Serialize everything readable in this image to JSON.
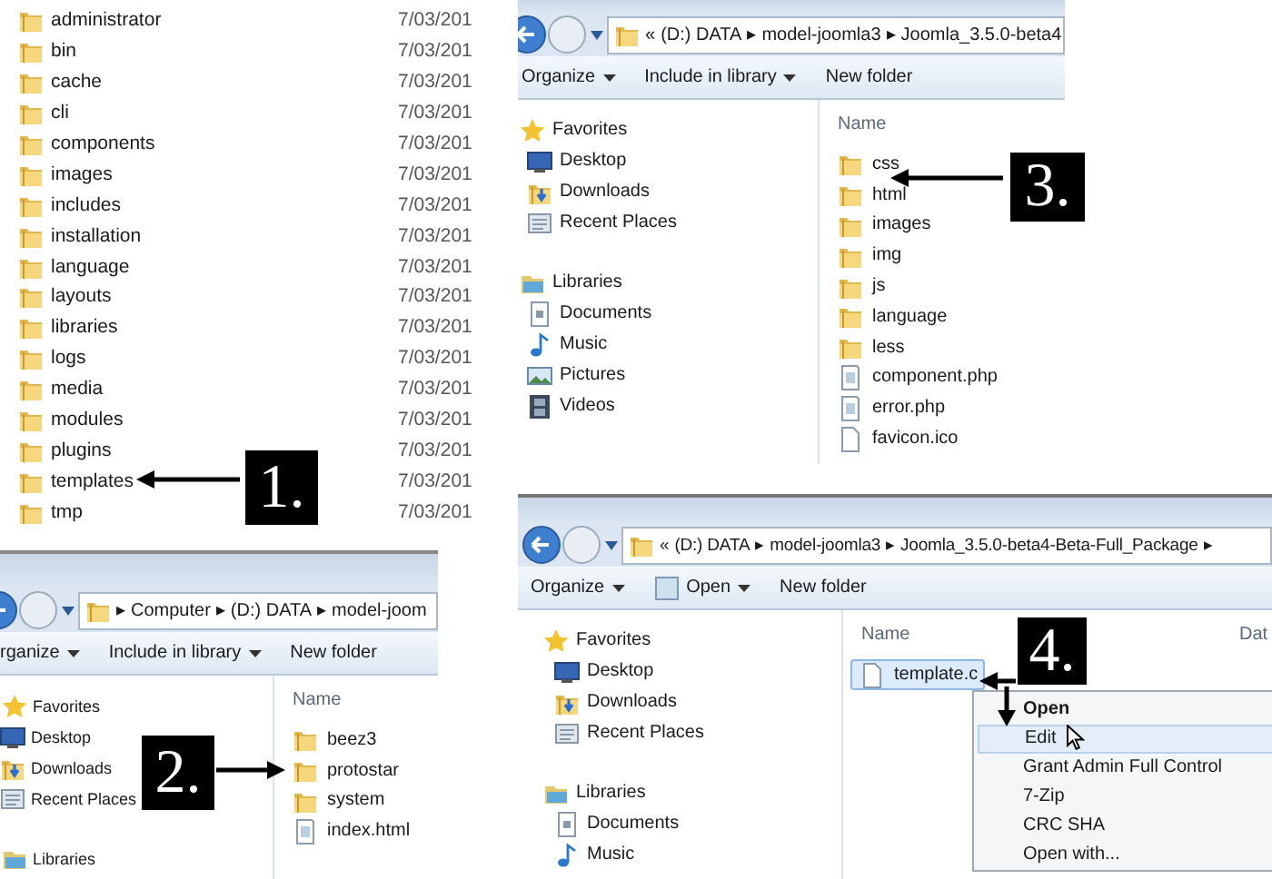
{
  "panels": [
    {
      "kind": "list",
      "rows": [
        {
          "name": "administrator",
          "date": "7/03/201"
        },
        {
          "name": "bin",
          "date": "7/03/201"
        },
        {
          "name": "cache",
          "date": "7/03/201"
        },
        {
          "name": "cli",
          "date": "7/03/201"
        },
        {
          "name": "components",
          "date": "7/03/201"
        },
        {
          "name": "images",
          "date": "7/03/201"
        },
        {
          "name": "includes",
          "date": "7/03/201"
        },
        {
          "name": "installation",
          "date": "7/03/201"
        },
        {
          "name": "language",
          "date": "7/03/201"
        },
        {
          "name": "layouts",
          "date": "7/03/201"
        },
        {
          "name": "libraries",
          "date": "7/03/201"
        },
        {
          "name": "logs",
          "date": "7/03/201"
        },
        {
          "name": "media",
          "date": "7/03/201"
        },
        {
          "name": "modules",
          "date": "7/03/201"
        },
        {
          "name": "plugins",
          "date": "7/03/201"
        },
        {
          "name": "templates",
          "date": "7/03/201"
        },
        {
          "name": "tmp",
          "date": "7/03/201"
        }
      ],
      "callout": {
        "label": "1."
      }
    },
    {
      "kind": "explorer",
      "address": [
        "▸",
        "Computer",
        "▸",
        "(D:) DATA",
        "▸",
        "model-joom"
      ],
      "toolbar": [
        {
          "label": "rganize",
          "dropdown": true,
          "icon": false
        },
        {
          "label": "Include in library",
          "dropdown": true,
          "icon": false
        },
        {
          "label": "New folder",
          "dropdown": false,
          "icon": false
        }
      ],
      "nav": [
        {
          "label": "Favorites",
          "kind": "star",
          "children": [
            {
              "label": "Desktop",
              "kind": "desktop"
            },
            {
              "label": "Downloads",
              "kind": "downloads"
            },
            {
              "label": "Recent Places",
              "kind": "recent"
            }
          ]
        },
        {
          "label": "Libraries",
          "kind": "libraries"
        }
      ],
      "columns": [
        "Name"
      ],
      "files": [
        {
          "name": "beez3",
          "kind": "folder",
          "selected": false
        },
        {
          "name": "protostar",
          "kind": "folder",
          "selected": false
        },
        {
          "name": "system",
          "kind": "folder",
          "selected": false
        },
        {
          "name": "index.html",
          "kind": "page",
          "selected": false
        }
      ],
      "callout": {
        "label": "2."
      }
    },
    {
      "kind": "explorer",
      "address": [
        "«",
        "(D:) DATA",
        "▸",
        "model-joomla3",
        "▸",
        "Joomla_3.5.0-beta4"
      ],
      "toolbar": [
        {
          "label": "Organize",
          "dropdown": true,
          "icon": false
        },
        {
          "label": "Include in library",
          "dropdown": true,
          "icon": false
        },
        {
          "label": "New folder",
          "dropdown": false,
          "icon": false
        }
      ],
      "nav": [
        {
          "label": "Favorites",
          "kind": "star",
          "children": [
            {
              "label": "Desktop",
              "kind": "desktop"
            },
            {
              "label": "Downloads",
              "kind": "downloads"
            },
            {
              "label": "Recent Places",
              "kind": "recent"
            }
          ]
        },
        {
          "label": "Libraries",
          "kind": "libraries",
          "children": [
            {
              "label": "Documents",
              "kind": "documents"
            },
            {
              "label": "Music",
              "kind": "music"
            },
            {
              "label": "Pictures",
              "kind": "pictures"
            },
            {
              "label": "Videos",
              "kind": "videos"
            }
          ]
        }
      ],
      "columns": [
        "Name"
      ],
      "files": [
        {
          "name": "css",
          "kind": "folder",
          "selected": false
        },
        {
          "name": "html",
          "kind": "folder",
          "selected": false
        },
        {
          "name": "images",
          "kind": "folder",
          "selected": false
        },
        {
          "name": "img",
          "kind": "folder",
          "selected": false
        },
        {
          "name": "js",
          "kind": "folder",
          "selected": false
        },
        {
          "name": "language",
          "kind": "folder",
          "selected": false
        },
        {
          "name": "less",
          "kind": "folder",
          "selected": false
        },
        {
          "name": "component.php",
          "kind": "page",
          "selected": false
        },
        {
          "name": "error.php",
          "kind": "page",
          "selected": false
        },
        {
          "name": "favicon.ico",
          "kind": "blank",
          "selected": false
        }
      ],
      "callout": {
        "label": "3."
      }
    },
    {
      "kind": "explorer",
      "address": [
        "«",
        "(D:) DATA",
        "▸",
        "model-joomla3",
        "▸",
        "Joomla_3.5.0-beta4-Beta-Full_Package",
        "▸"
      ],
      "toolbar": [
        {
          "label": "Organize",
          "dropdown": true,
          "icon": false
        },
        {
          "label": "Open",
          "dropdown": true,
          "icon": true
        },
        {
          "label": "New folder",
          "dropdown": false,
          "icon": false
        }
      ],
      "nav": [
        {
          "label": "Favorites",
          "kind": "star",
          "children": [
            {
              "label": "Desktop",
              "kind": "desktop"
            },
            {
              "label": "Downloads",
              "kind": "downloads"
            },
            {
              "label": "Recent Places",
              "kind": "recent"
            }
          ]
        },
        {
          "label": "Libraries",
          "kind": "libraries",
          "children": [
            {
              "label": "Documents",
              "kind": "documents"
            },
            {
              "label": "Music",
              "kind": "music"
            }
          ]
        }
      ],
      "columns": [
        "Name",
        "Dat"
      ],
      "files": [
        {
          "name": "template.c",
          "kind": "blank",
          "selected": true
        }
      ],
      "menu": [
        {
          "label": "Open",
          "default": true,
          "selected": false
        },
        {
          "label": "Edit",
          "default": false,
          "selected": true
        },
        {
          "label": "Grant Admin Full Control",
          "default": false,
          "selected": false
        },
        {
          "label": "7-Zip",
          "default": false,
          "selected": false
        },
        {
          "label": "CRC SHA",
          "default": false,
          "selected": false
        },
        {
          "label": "Open with...",
          "default": false,
          "selected": false
        }
      ],
      "cursor": true,
      "callout": {
        "label": "4."
      }
    }
  ]
}
